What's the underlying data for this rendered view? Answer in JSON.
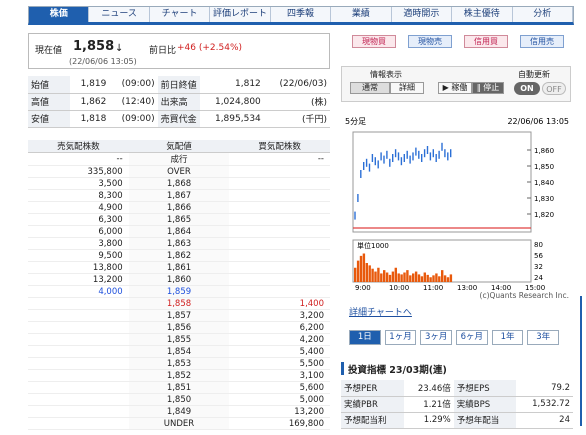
{
  "tabs": [
    "株価",
    "ニュース",
    "チャート",
    "評価レポート",
    "四季報",
    "業績",
    "適時開示",
    "株主優待",
    "分析"
  ],
  "price": {
    "label": "現在値",
    "value": "1,858",
    "arrow": "↓",
    "datetime": "(22/06/06 13:05)",
    "change_label": "前日比",
    "change": "+46 (+2.54%)"
  },
  "buttons": [
    "現物買",
    "現物売",
    "信用買",
    "信用売"
  ],
  "stats": [
    [
      "始値",
      "1,819",
      "(09:00)",
      "前日終値",
      "1,812",
      "(22/06/03)"
    ],
    [
      "高値",
      "1,862",
      "(12:40)",
      "出来高",
      "1,024,800",
      "(株)"
    ],
    [
      "安値",
      "1,818",
      "(09:00)",
      "売買代金",
      "1,895,534",
      "(千円)"
    ]
  ],
  "controls": {
    "info_label": "情報表示",
    "mode_normal": "通常",
    "mode_detail": "詳細",
    "play": "▶ 稼働",
    "pause": "‖ 停止",
    "auto_label": "自動更新",
    "on": "ON",
    "off": "OFF"
  },
  "book": {
    "headers": [
      "売気配株数",
      "気配値",
      "買気配株数"
    ],
    "rows": [
      [
        "--",
        "成行",
        "--"
      ],
      [
        "335,800",
        "OVER",
        ""
      ],
      [
        "3,500",
        "1,868",
        ""
      ],
      [
        "8,300",
        "1,867",
        ""
      ],
      [
        "4,900",
        "1,866",
        ""
      ],
      [
        "6,300",
        "1,865",
        ""
      ],
      [
        "6,000",
        "1,864",
        ""
      ],
      [
        "3,800",
        "1,863",
        ""
      ],
      [
        "9,500",
        "1,862",
        ""
      ],
      [
        "13,800",
        "1,861",
        ""
      ],
      [
        "13,200",
        "1,860",
        ""
      ],
      [
        "4,000",
        "1,859",
        ""
      ],
      [
        "",
        "1,858",
        "1,400"
      ],
      [
        "",
        "1,857",
        "3,200"
      ],
      [
        "",
        "1,856",
        "6,200"
      ],
      [
        "",
        "1,855",
        "4,200"
      ],
      [
        "",
        "1,854",
        "5,400"
      ],
      [
        "",
        "1,853",
        "5,500"
      ],
      [
        "",
        "1,852",
        "3,100"
      ],
      [
        "",
        "1,851",
        "5,600"
      ],
      [
        "",
        "1,850",
        "5,000"
      ],
      [
        "",
        "1,849",
        "13,200"
      ],
      [
        "",
        "UNDER",
        "169,800"
      ]
    ]
  },
  "chart": {
    "interval": "5分足",
    "datetime": "22/06/06 13:05",
    "y_ticks": [
      "1,860",
      "1,850",
      "1,840",
      "1,830",
      "1,820"
    ],
    "vol_label": "単位1000",
    "vol_ticks": [
      "80",
      "56",
      "32",
      "24"
    ],
    "x_ticks": [
      "9:00",
      "10:00",
      "11:00",
      "13:00",
      "14:00",
      "15:00"
    ],
    "credit": "(c)Quants Research Inc."
  },
  "chart_data": {
    "type": "line",
    "x_ticks": [
      "9:00",
      "10:00",
      "11:00",
      "13:00",
      "14:00",
      "15:00"
    ],
    "ylim": [
      1810,
      1870
    ],
    "series": [
      {
        "values": [
          1819,
          1830,
          1845,
          1850,
          1852,
          1849,
          1855,
          1853,
          1851,
          1856,
          1854,
          1857,
          1852,
          1855,
          1858,
          1856,
          1853,
          1855,
          1857,
          1854,
          1856,
          1859,
          1857,
          1855,
          1858,
          1860,
          1856,
          1858,
          1855,
          1857,
          1862,
          1858,
          1856,
          1858
        ]
      }
    ],
    "volume": [
      30,
      45,
      55,
      60,
      40,
      35,
      28,
      22,
      30,
      18,
      25,
      20,
      15,
      22,
      30,
      18,
      16,
      20,
      25,
      14,
      18,
      22,
      16,
      12,
      20,
      15,
      10,
      14,
      18,
      12,
      25,
      14,
      10,
      16
    ]
  },
  "link": "詳細チャートへ",
  "periods": [
    "1日",
    "1ヶ月",
    "3ヶ月",
    "6ヶ月",
    "1年",
    "3年"
  ],
  "indicators": {
    "title": "投資指標 23/03期(連)",
    "rows": [
      [
        "予想PER",
        "23.46倍",
        "予想EPS",
        "79.2"
      ],
      [
        "実績PBR",
        "1.21倍",
        "実績BPS",
        "1,532.72"
      ],
      [
        "予想配当利",
        "1.29%",
        "予想年配当",
        "24"
      ]
    ]
  },
  "colors": {
    "accent": "#1f5fae",
    "up": "#d02020",
    "candle": "#2b6fd6",
    "volume": "#e8590c"
  }
}
